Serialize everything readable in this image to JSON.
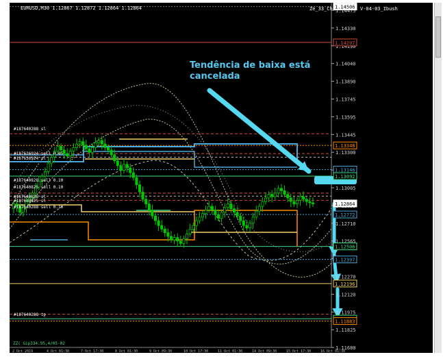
{
  "window": {
    "symbol_info": "EURUSD,M30  1.12867 1.12872 1.12864 1.12864",
    "expert_info": "Ze_33_Ch...",
    "template_info": "V-04-03_Ibush"
  },
  "annotation": {
    "line1": "Tendência de baixa está",
    "line2": "cancelada"
  },
  "bottom_label": "ZZ(  Gip334.95,4/05-02",
  "order_labels": [
    {
      "text": "#187640288 sl"
    },
    {
      "text": "#187636924 sell 0.05"
    },
    {
      "text": "#187636924 sl"
    },
    {
      "text": "#187640828 sell 0.10"
    },
    {
      "text": "#187640825 sell 0.10"
    },
    {
      "text": "#187640288 sell 0.10"
    },
    {
      "text": "#187640828 sl"
    },
    {
      "text": "#187640825 sl"
    },
    {
      "text": "#187640288 tp"
    }
  ],
  "price_scale": [
    "1.14475",
    "1.14330",
    "1.14190",
    "1.14040",
    "1.13890",
    "1.13745",
    "1.13595",
    "1.13445",
    "1.13300",
    "1.13150",
    "1.13005",
    "1.12855",
    "1.12710",
    "1.12565",
    "1.12415",
    "1.12270",
    "1.12120",
    "1.11975",
    "1.11825",
    "1.11680"
  ],
  "price_tags": [
    {
      "price": "1.14506",
      "color": "#ffffff"
    },
    {
      "price": "1.14207",
      "color": "#d24b3a"
    },
    {
      "price": "1.13348",
      "color": "#ff8c00"
    },
    {
      "price": "1.13146",
      "color": "#4aa8d8"
    },
    {
      "price": "1.13092",
      "color": "#3ddc84"
    },
    {
      "price": "1.12864",
      "color": "#ffffff"
    },
    {
      "price": "1.12772",
      "color": "#4aa8d8"
    },
    {
      "price": "1.12506",
      "color": "#3ddc84"
    },
    {
      "price": "1.12397",
      "color": "#4aa8d8"
    },
    {
      "price": "1.12196",
      "color": "#f0d264"
    },
    {
      "price": "1.11903",
      "color": "#3ddc84"
    },
    {
      "price": "1.11883",
      "color": "#ff8c00"
    }
  ],
  "time_axis": [
    "2 Oct 2019",
    "4 Oct 01:30",
    "7 Oct 17:30",
    "8 Oct 01:30",
    "9 Oct 09:30",
    "10 Oct 17:30",
    "11 Oct 01:30",
    "14 Oct 09:30",
    "15 Oct 17:30",
    "16 Oct 01:30"
  ],
  "colors": {
    "background": "#000000",
    "bull_candle": "#00c800",
    "arrow": "#56d8f0",
    "annotation_text": "#56c8f0",
    "level_green": "#3ddc84",
    "level_blue": "#4aa8d8",
    "level_orange": "#ff8c00",
    "level_yellow": "#f0d264",
    "level_red": "#d24b3a"
  }
}
